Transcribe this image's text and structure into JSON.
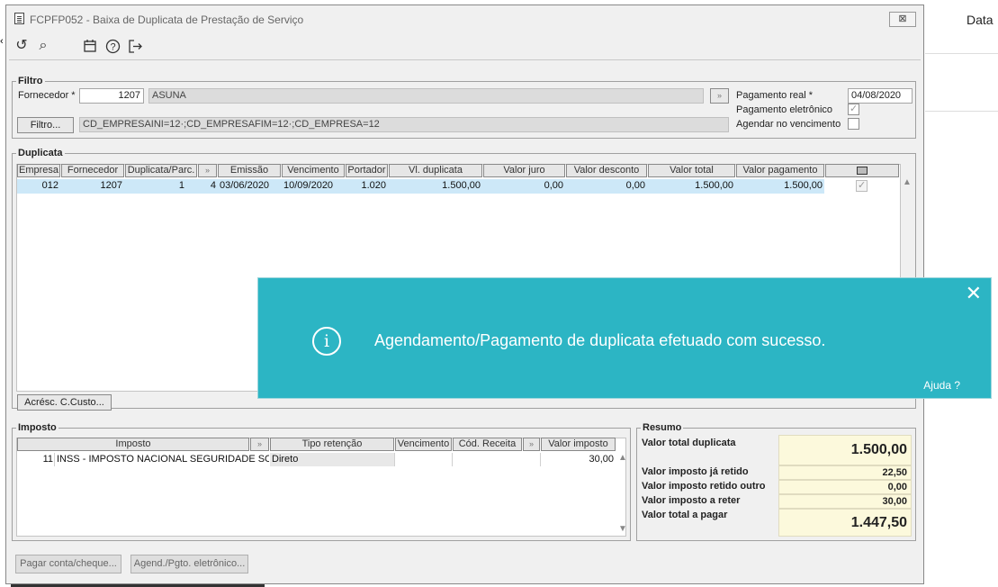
{
  "background": {
    "header_text": "Data"
  },
  "window": {
    "title": "FCPFP052 - Baixa de Duplicata de Prestação de Serviço",
    "close_label": "⊠"
  },
  "toolbar": [
    {
      "name": "refresh-icon",
      "glyph": "↺"
    },
    {
      "name": "search-icon",
      "glyph": "⌕"
    },
    {
      "name": "calendar-icon",
      "glyph": "▦"
    },
    {
      "name": "help-icon",
      "glyph": "?"
    },
    {
      "name": "exit-icon",
      "glyph": "↦"
    }
  ],
  "filtro": {
    "legend": "Filtro",
    "fornecedor_label": "Fornecedor *",
    "fornecedor_code": "1207",
    "fornecedor_name": "ASUNA",
    "lookup_btn": "»",
    "filtro_btn": "Filtro...",
    "filtro_text": "CD_EMPRESAINI=12·;CD_EMPRESAFIM=12·;CD_EMPRESA=12",
    "pagamento_real_label": "Pagamento real *",
    "pagamento_real_value": "04/08/2020",
    "pagamento_eletronico_label": "Pagamento eletrônico",
    "pagamento_eletronico_checked": true,
    "agendar_label": "Agendar no vencimento",
    "agendar_checked": false
  },
  "duplicata": {
    "legend": "Duplicata",
    "headers": [
      "Empresa",
      "Fornecedor",
      "Duplicata/Parc.",
      "»",
      "Emissão",
      "Vencimento",
      "Portador",
      "Vl. duplicata",
      "Valor juro",
      "Valor desconto",
      "Valor total",
      "Valor pagamento"
    ],
    "rows": [
      [
        "012",
        "1207",
        "1",
        "4",
        "03/06/2020",
        "10/09/2020",
        "1.020",
        "1.500,00",
        "0,00",
        "0,00",
        "1.500,00",
        "1.500,00"
      ]
    ],
    "acresc_btn": "Acrésc. C.Custo..."
  },
  "imposto": {
    "legend": "Imposto",
    "headers": [
      "Imposto",
      "»",
      "Tipo retenção",
      "Vencimento",
      "Cód. Receita",
      "»",
      "Valor imposto"
    ],
    "rows": [
      [
        "11",
        "INSS - IMPOSTO NACIONAL SEGURIDADE SOCIAL",
        "Direto",
        "",
        "",
        "30,00"
      ]
    ]
  },
  "resumo": {
    "legend": "Resumo",
    "items": [
      {
        "label": "Valor total duplicata",
        "value": "1.500,00"
      },
      {
        "label": "Valor imposto já retido",
        "value": "22,50"
      },
      {
        "label": "Valor imposto retido outro",
        "value": "0,00"
      },
      {
        "label": "Valor imposto a reter",
        "value": "30,00"
      },
      {
        "label": "Valor total a pagar",
        "value": "1.447,50"
      }
    ]
  },
  "buttons": {
    "pagar": "Pagar conta/cheque...",
    "agend": "Agend./Pgto. eletrônico..."
  },
  "toast": {
    "message": "Agendamento/Pagamento de duplicata efetuado com sucesso.",
    "close": "✕",
    "help": "Ajuda ?",
    "icon": "i",
    "color": "#2cb5c4"
  }
}
